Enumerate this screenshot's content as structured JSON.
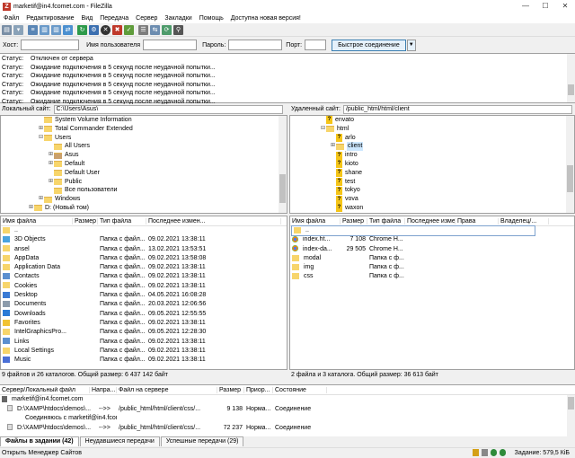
{
  "window": {
    "title": "marketif@in4.fcomet.com - FileZilla",
    "icon_letter": "Z"
  },
  "menu": [
    "Файл",
    "Редактирование",
    "Вид",
    "Передача",
    "Сервер",
    "Закладки",
    "Помощь",
    "Доступна новая версия!"
  ],
  "quickconnect": {
    "host_label": "Хост:",
    "host_value": "",
    "user_label": "Имя пользователя",
    "user_value": "",
    "pass_label": "Пароль:",
    "pass_value": "",
    "port_label": "Порт:",
    "port_value": "",
    "button": "Быстрое соединение",
    "dropdown": "▼"
  },
  "log": [
    {
      "k": "Статус:",
      "v": "Отключен от сервера"
    },
    {
      "k": "Статус:",
      "v": "Ожидание подключения в 5 секунд после неудачной попытки..."
    },
    {
      "k": "Статус:",
      "v": "Ожидание подключения в 5 секунд после неудачной попытки..."
    },
    {
      "k": "Статус:",
      "v": "Ожидание подключения в 5 секунд после неудачной попытки..."
    },
    {
      "k": "Статус:",
      "v": "Ожидание подключения в 5 секунд после неудачной попытки..."
    },
    {
      "k": "Статус:",
      "v": "Ожидание подключения в 5 секунд после неудачной попытки..."
    }
  ],
  "local": {
    "path_label": "Локальный сайт:",
    "path": "C:\\Users\\Asus\\",
    "tree": [
      {
        "label": "System Volume Information",
        "exp": "",
        "ind": 1
      },
      {
        "label": "Total Commander Extended",
        "exp": "⊞",
        "ind": 1
      },
      {
        "label": "Users",
        "exp": "⊟",
        "ind": 1
      },
      {
        "label": "All Users",
        "exp": "",
        "ind": 2
      },
      {
        "label": "Asus",
        "exp": "⊞",
        "ind": 2
      },
      {
        "label": "Default",
        "exp": "⊞",
        "ind": 2
      },
      {
        "label": "Default User",
        "exp": "",
        "ind": 2
      },
      {
        "label": "Public",
        "exp": "⊞",
        "ind": 2
      },
      {
        "label": "Все пользователи",
        "exp": "",
        "ind": 2
      },
      {
        "label": "Windows",
        "exp": "⊞",
        "ind": 1
      },
      {
        "label": "D: (Новый том)",
        "exp": "⊞",
        "ind": 0
      }
    ],
    "headers": [
      "Имя файла",
      "Размер",
      "Тип файла",
      "Последнее измен..."
    ],
    "files": [
      {
        "name": "..",
        "size": "",
        "type": "",
        "date": "",
        "color": "#f7d56b"
      },
      {
        "name": "3D Objects",
        "size": "",
        "type": "Папка с файл...",
        "date": "09.02.2021 13:38:11",
        "color": "#4aa3df"
      },
      {
        "name": "ansel",
        "size": "",
        "type": "Папка с файл...",
        "date": "13.02.2021 13:53:51",
        "color": "#f7d56b"
      },
      {
        "name": "AppData",
        "size": "",
        "type": "Папка с файл...",
        "date": "09.02.2021 13:58:08",
        "color": "#f7d56b"
      },
      {
        "name": "Application Data",
        "size": "",
        "type": "Папка с файл...",
        "date": "09.02.2021 13:38:11",
        "color": "#f7d56b"
      },
      {
        "name": "Contacts",
        "size": "",
        "type": "Папка с файл...",
        "date": "09.02.2021 13:38:11",
        "color": "#5b8fcf"
      },
      {
        "name": "Cookies",
        "size": "",
        "type": "Папка с файл...",
        "date": "09.02.2021 13:38:11",
        "color": "#f7d56b"
      },
      {
        "name": "Desktop",
        "size": "",
        "type": "Папка с файл...",
        "date": "04.05.2021 16:08:28",
        "color": "#3a7bd5"
      },
      {
        "name": "Documents",
        "size": "",
        "type": "Папка с файл...",
        "date": "20.03.2021 12:06:56",
        "color": "#8c9bab"
      },
      {
        "name": "Downloads",
        "size": "",
        "type": "Папка с файл...",
        "date": "09.05.2021 12:55:55",
        "color": "#2b7bd6"
      },
      {
        "name": "Favorites",
        "size": "",
        "type": "Папка с файл...",
        "date": "09.02.2021 13:38:11",
        "color": "#f1c232"
      },
      {
        "name": "IntelGraphicsPro...",
        "size": "",
        "type": "Папка с файл...",
        "date": "09.05.2021 12:28:30",
        "color": "#f7d56b"
      },
      {
        "name": "Links",
        "size": "",
        "type": "Папка с файл...",
        "date": "09.02.2021 13:38:11",
        "color": "#5b8fcf"
      },
      {
        "name": "Local Settings",
        "size": "",
        "type": "Папка с файл...",
        "date": "09.02.2021 13:38:11",
        "color": "#f7d56b"
      },
      {
        "name": "Music",
        "size": "",
        "type": "Папка с файл...",
        "date": "09.02.2021 13:38:11",
        "color": "#4a6fd6"
      }
    ],
    "summary": "9 файлов и 26 каталогов. Общий размер: 6 437 142 байт"
  },
  "remote": {
    "path_label": "Удаленный сайт:",
    "path": "/public_html/html/client",
    "tree": [
      {
        "label": "envato",
        "exp": "",
        "ind": 1,
        "kind": "q"
      },
      {
        "label": "html",
        "exp": "⊟",
        "ind": 1,
        "kind": "f"
      },
      {
        "label": "arlo",
        "exp": "",
        "ind": 2,
        "kind": "q"
      },
      {
        "label": "client",
        "exp": "⊞",
        "ind": 2,
        "kind": "f"
      },
      {
        "label": "intro",
        "exp": "",
        "ind": 2,
        "kind": "q"
      },
      {
        "label": "kioto",
        "exp": "",
        "ind": 2,
        "kind": "q"
      },
      {
        "label": "shane",
        "exp": "",
        "ind": 2,
        "kind": "q"
      },
      {
        "label": "test",
        "exp": "",
        "ind": 2,
        "kind": "q"
      },
      {
        "label": "tokyo",
        "exp": "",
        "ind": 2,
        "kind": "q"
      },
      {
        "label": "vova",
        "exp": "",
        "ind": 2,
        "kind": "q"
      },
      {
        "label": "waxon",
        "exp": "",
        "ind": 2,
        "kind": "q"
      }
    ],
    "headers": [
      "Имя файла",
      "Размер",
      "Тип файла",
      "Последнее изме...",
      "Права",
      "Владелец/..."
    ],
    "files": [
      {
        "name": "..",
        "size": "",
        "type": "",
        "kind": "f"
      },
      {
        "name": "index.ht...",
        "size": "7 108",
        "type": "Chrome H...",
        "kind": "c"
      },
      {
        "name": "index-da...",
        "size": "29 505",
        "type": "Chrome H...",
        "kind": "c"
      },
      {
        "name": "modal",
        "size": "",
        "type": "Папка с ф...",
        "kind": "f"
      },
      {
        "name": "img",
        "size": "",
        "type": "Папка с ф...",
        "kind": "f"
      },
      {
        "name": "css",
        "size": "",
        "type": "Папка с ф...",
        "kind": "f"
      }
    ],
    "summary": "2 файла и 3 каталога. Общий размер: 36 613 байт"
  },
  "queue": {
    "headers": [
      "Сервер/Локальный файл",
      "Напра...",
      "Файл на сервере",
      "Размер",
      "Приор...",
      "Состояние"
    ],
    "rows": [
      {
        "server": "marketif@in4.fcomet.com",
        "dir": "",
        "remote": "",
        "size": "",
        "prio": "",
        "state": "",
        "kind": "server"
      },
      {
        "server": "D:\\XAMP\\htdocs\\demos\\...",
        "dir": "-->>",
        "remote": "/public_html/html/client/css/...",
        "size": "9 138",
        "prio": "Норма...",
        "state": "Соединение",
        "kind": "file"
      },
      {
        "server": "Соединяюсь с marketif@in4.fcomet.com",
        "dir": "",
        "remote": "",
        "size": "",
        "prio": "",
        "state": "",
        "kind": "note"
      },
      {
        "server": "D:\\XAMP\\htdocs\\demos\\...",
        "dir": "-->>",
        "remote": "/public_html/html/client/css/...",
        "size": "72 237",
        "prio": "Норма...",
        "state": "Соединение",
        "kind": "file"
      }
    ]
  },
  "tabs": [
    "Файлы в задании (42)",
    "Неудавшиеся передачи",
    "Успешные передачи (29)"
  ],
  "status": {
    "left": "Открыть Менеджер Сайтов",
    "right": "Задание: 579,5 КіБ"
  }
}
